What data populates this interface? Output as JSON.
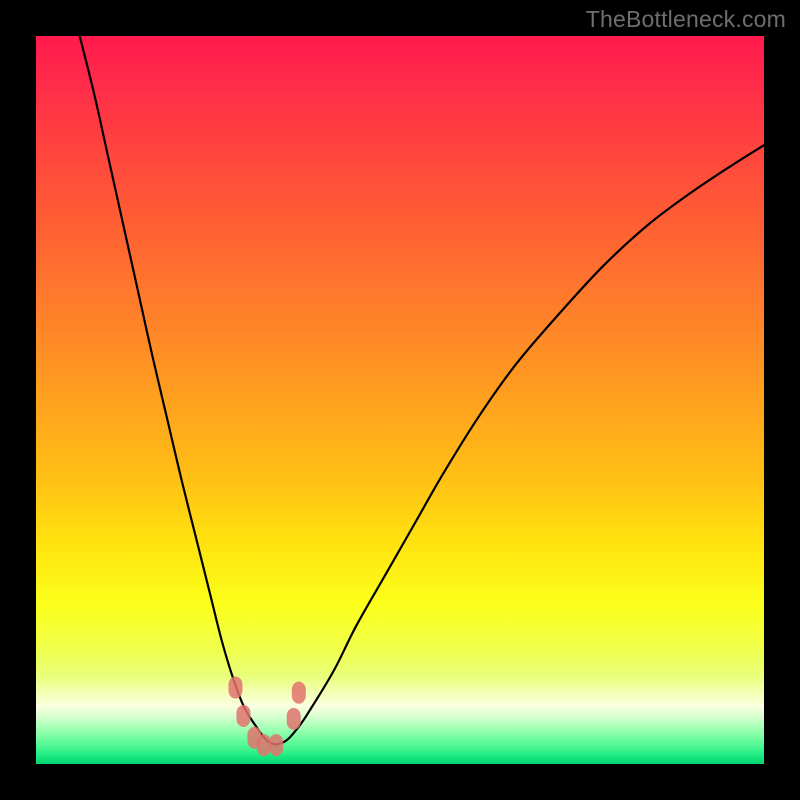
{
  "watermark": "TheBottleneck.com",
  "chart_data": {
    "type": "line",
    "title": "",
    "xlabel": "",
    "ylabel": "",
    "xlim": [
      0,
      100
    ],
    "ylim": [
      0,
      100
    ],
    "grid": false,
    "series": [
      {
        "name": "bottleneck-curve",
        "x": [
          6,
          8,
          10,
          12,
          14,
          16,
          18,
          20,
          22,
          24,
          25.5,
          27,
          28.5,
          30,
          32,
          34,
          36,
          38,
          41,
          44,
          48,
          52,
          56,
          61,
          66,
          72,
          78,
          84,
          90,
          96,
          100
        ],
        "y": [
          100,
          92,
          83,
          74,
          65,
          56,
          47.5,
          39,
          31,
          23,
          17,
          12,
          8,
          5.5,
          3,
          3,
          5,
          8,
          13,
          19,
          26,
          33,
          40,
          48,
          55,
          62,
          68.5,
          74,
          78.5,
          82.5,
          85
        ]
      }
    ],
    "markers": [
      {
        "name": "marker-left-start",
        "x": 27.4,
        "y": 10.5
      },
      {
        "name": "marker-left-mid",
        "x": 28.5,
        "y": 6.6
      },
      {
        "name": "marker-bottom-1",
        "x": 30.0,
        "y": 3.6
      },
      {
        "name": "marker-bottom-2",
        "x": 31.3,
        "y": 2.6
      },
      {
        "name": "marker-bottom-3",
        "x": 33.0,
        "y": 2.6
      },
      {
        "name": "marker-right-start",
        "x": 35.4,
        "y": 6.2
      },
      {
        "name": "marker-right-up",
        "x": 36.1,
        "y": 9.8
      }
    ],
    "gradient_stops": [
      {
        "offset": 0.0,
        "color": "#ff1a4d"
      },
      {
        "offset": 0.5,
        "color": "#ffb020"
      },
      {
        "offset": 0.8,
        "color": "#fbff30"
      },
      {
        "offset": 1.0,
        "color": "#06d473"
      }
    ]
  }
}
